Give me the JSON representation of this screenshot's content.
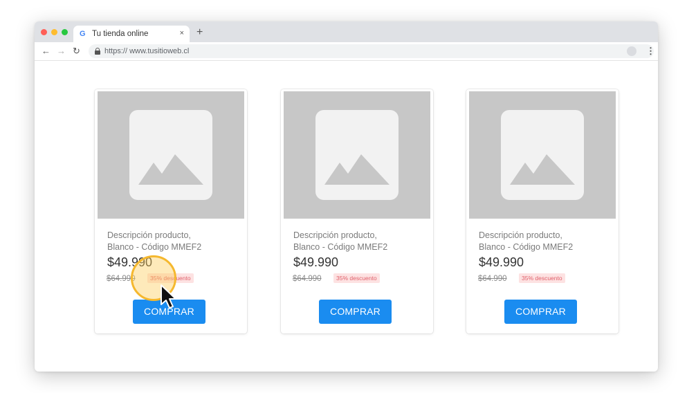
{
  "browser": {
    "tab_title": "Tu tienda online",
    "tab_close": "×",
    "new_tab": "+",
    "url": "https:// www.tusitioweb.cl",
    "icons": [
      "back-arrow-icon",
      "forward-arrow-icon",
      "reload-icon",
      "lock-icon",
      "star-icon",
      "profile-icon",
      "menu-icon",
      "google-favicon-icon"
    ]
  },
  "products": [
    {
      "desc_line1": "Descripción producto,",
      "desc_line2": "Blanco - Código MMEF2",
      "price": "$49.990",
      "old_price": "$64.990",
      "discount": "35% descuento",
      "button": "COMPRAR"
    },
    {
      "desc_line1": "Descripción producto,",
      "desc_line2": "Blanco - Código MMEF2",
      "price": "$49.990",
      "old_price": "$64.990",
      "discount": "35% descuento",
      "button": "COMPRAR"
    },
    {
      "desc_line1": "Descripción producto,",
      "desc_line2": "Blanco - Código MMEF2",
      "price": "$49.990",
      "old_price": "$64.990",
      "discount": "35% descuento",
      "button": "COMPRAR"
    }
  ],
  "colors": {
    "accent": "#1a8cf0",
    "discount_bg": "#fde2e2",
    "discount_text": "#e0606b",
    "highlight_ring": "#f5b82e"
  }
}
